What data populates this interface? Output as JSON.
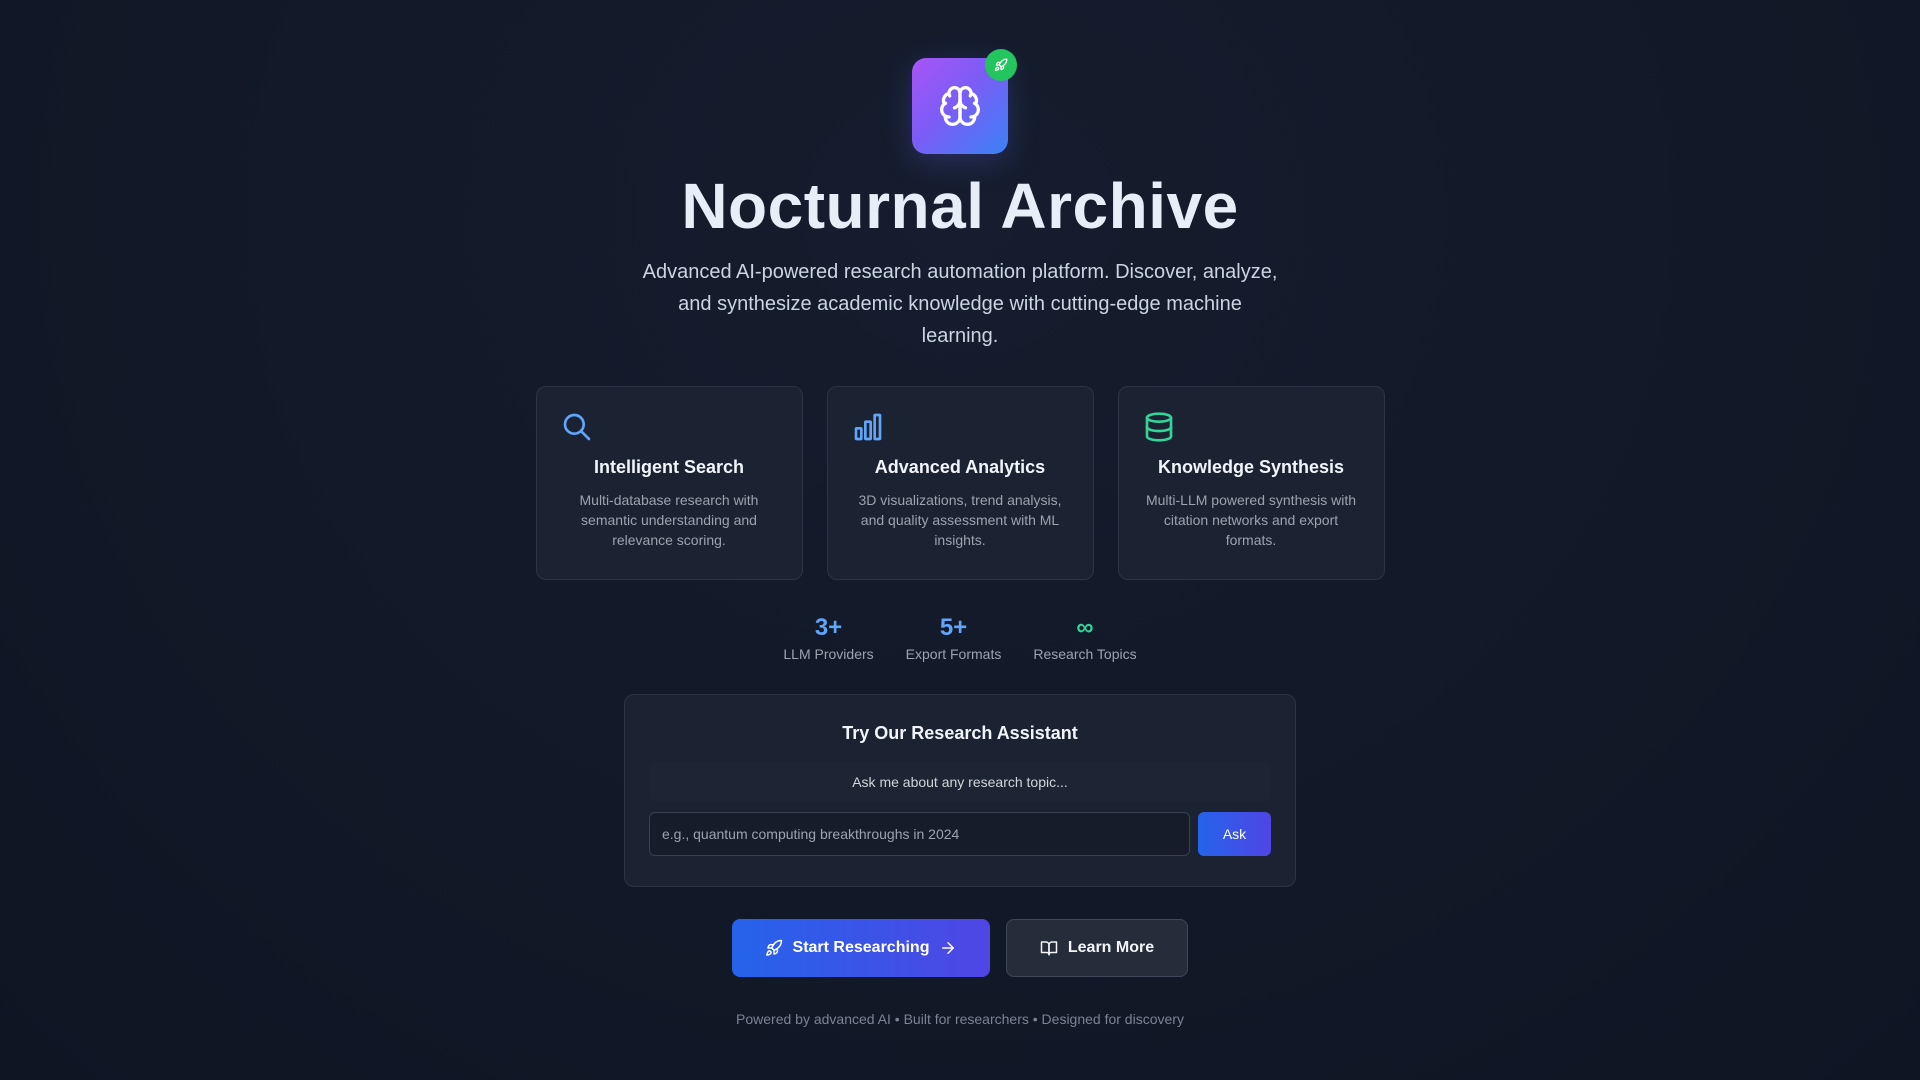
{
  "hero": {
    "title": "Nocturnal Archive",
    "subtitle": "Advanced AI-powered research automation platform. Discover, analyze, and synthesize academic knowledge with cutting-edge machine learning.",
    "logo_icon": "brain-icon",
    "badge_icon": "rocket-icon"
  },
  "features": [
    {
      "icon": "search-icon",
      "title": "Intelligent Search",
      "description": "Multi-database research with semantic understanding and relevance scoring."
    },
    {
      "icon": "bar-chart-icon",
      "title": "Advanced Analytics",
      "description": "3D visualizations, trend analysis, and quality assessment with ML insights."
    },
    {
      "icon": "database-icon",
      "title": "Knowledge Synthesis",
      "description": "Multi-LLM powered synthesis with citation networks and export formats."
    }
  ],
  "stats": [
    {
      "value": "3+",
      "label": "LLM Providers"
    },
    {
      "value": "5+",
      "label": "Export Formats"
    },
    {
      "value": "∞",
      "label": "Research Topics"
    }
  ],
  "assistant": {
    "title": "Try Our Research Assistant",
    "message": "Ask me about any research topic...",
    "input_placeholder": "e.g., quantum computing breakthroughs in 2024",
    "input_value": "",
    "ask_label": "Ask"
  },
  "cta": {
    "primary_label": "Start Researching",
    "secondary_label": "Learn More"
  },
  "footer": {
    "text": "Powered by advanced AI • Built for researchers • Designed for discovery"
  },
  "colors": {
    "background": "#111827",
    "card": "#1b2231",
    "accent_blue": "#60a5fa",
    "accent_green": "#34d399",
    "logo_gradient_start": "#a855f7",
    "logo_gradient_end": "#3b82f6",
    "badge": "#22c55e",
    "button_gradient_start": "#2563eb",
    "button_gradient_end": "#4f46e5"
  }
}
